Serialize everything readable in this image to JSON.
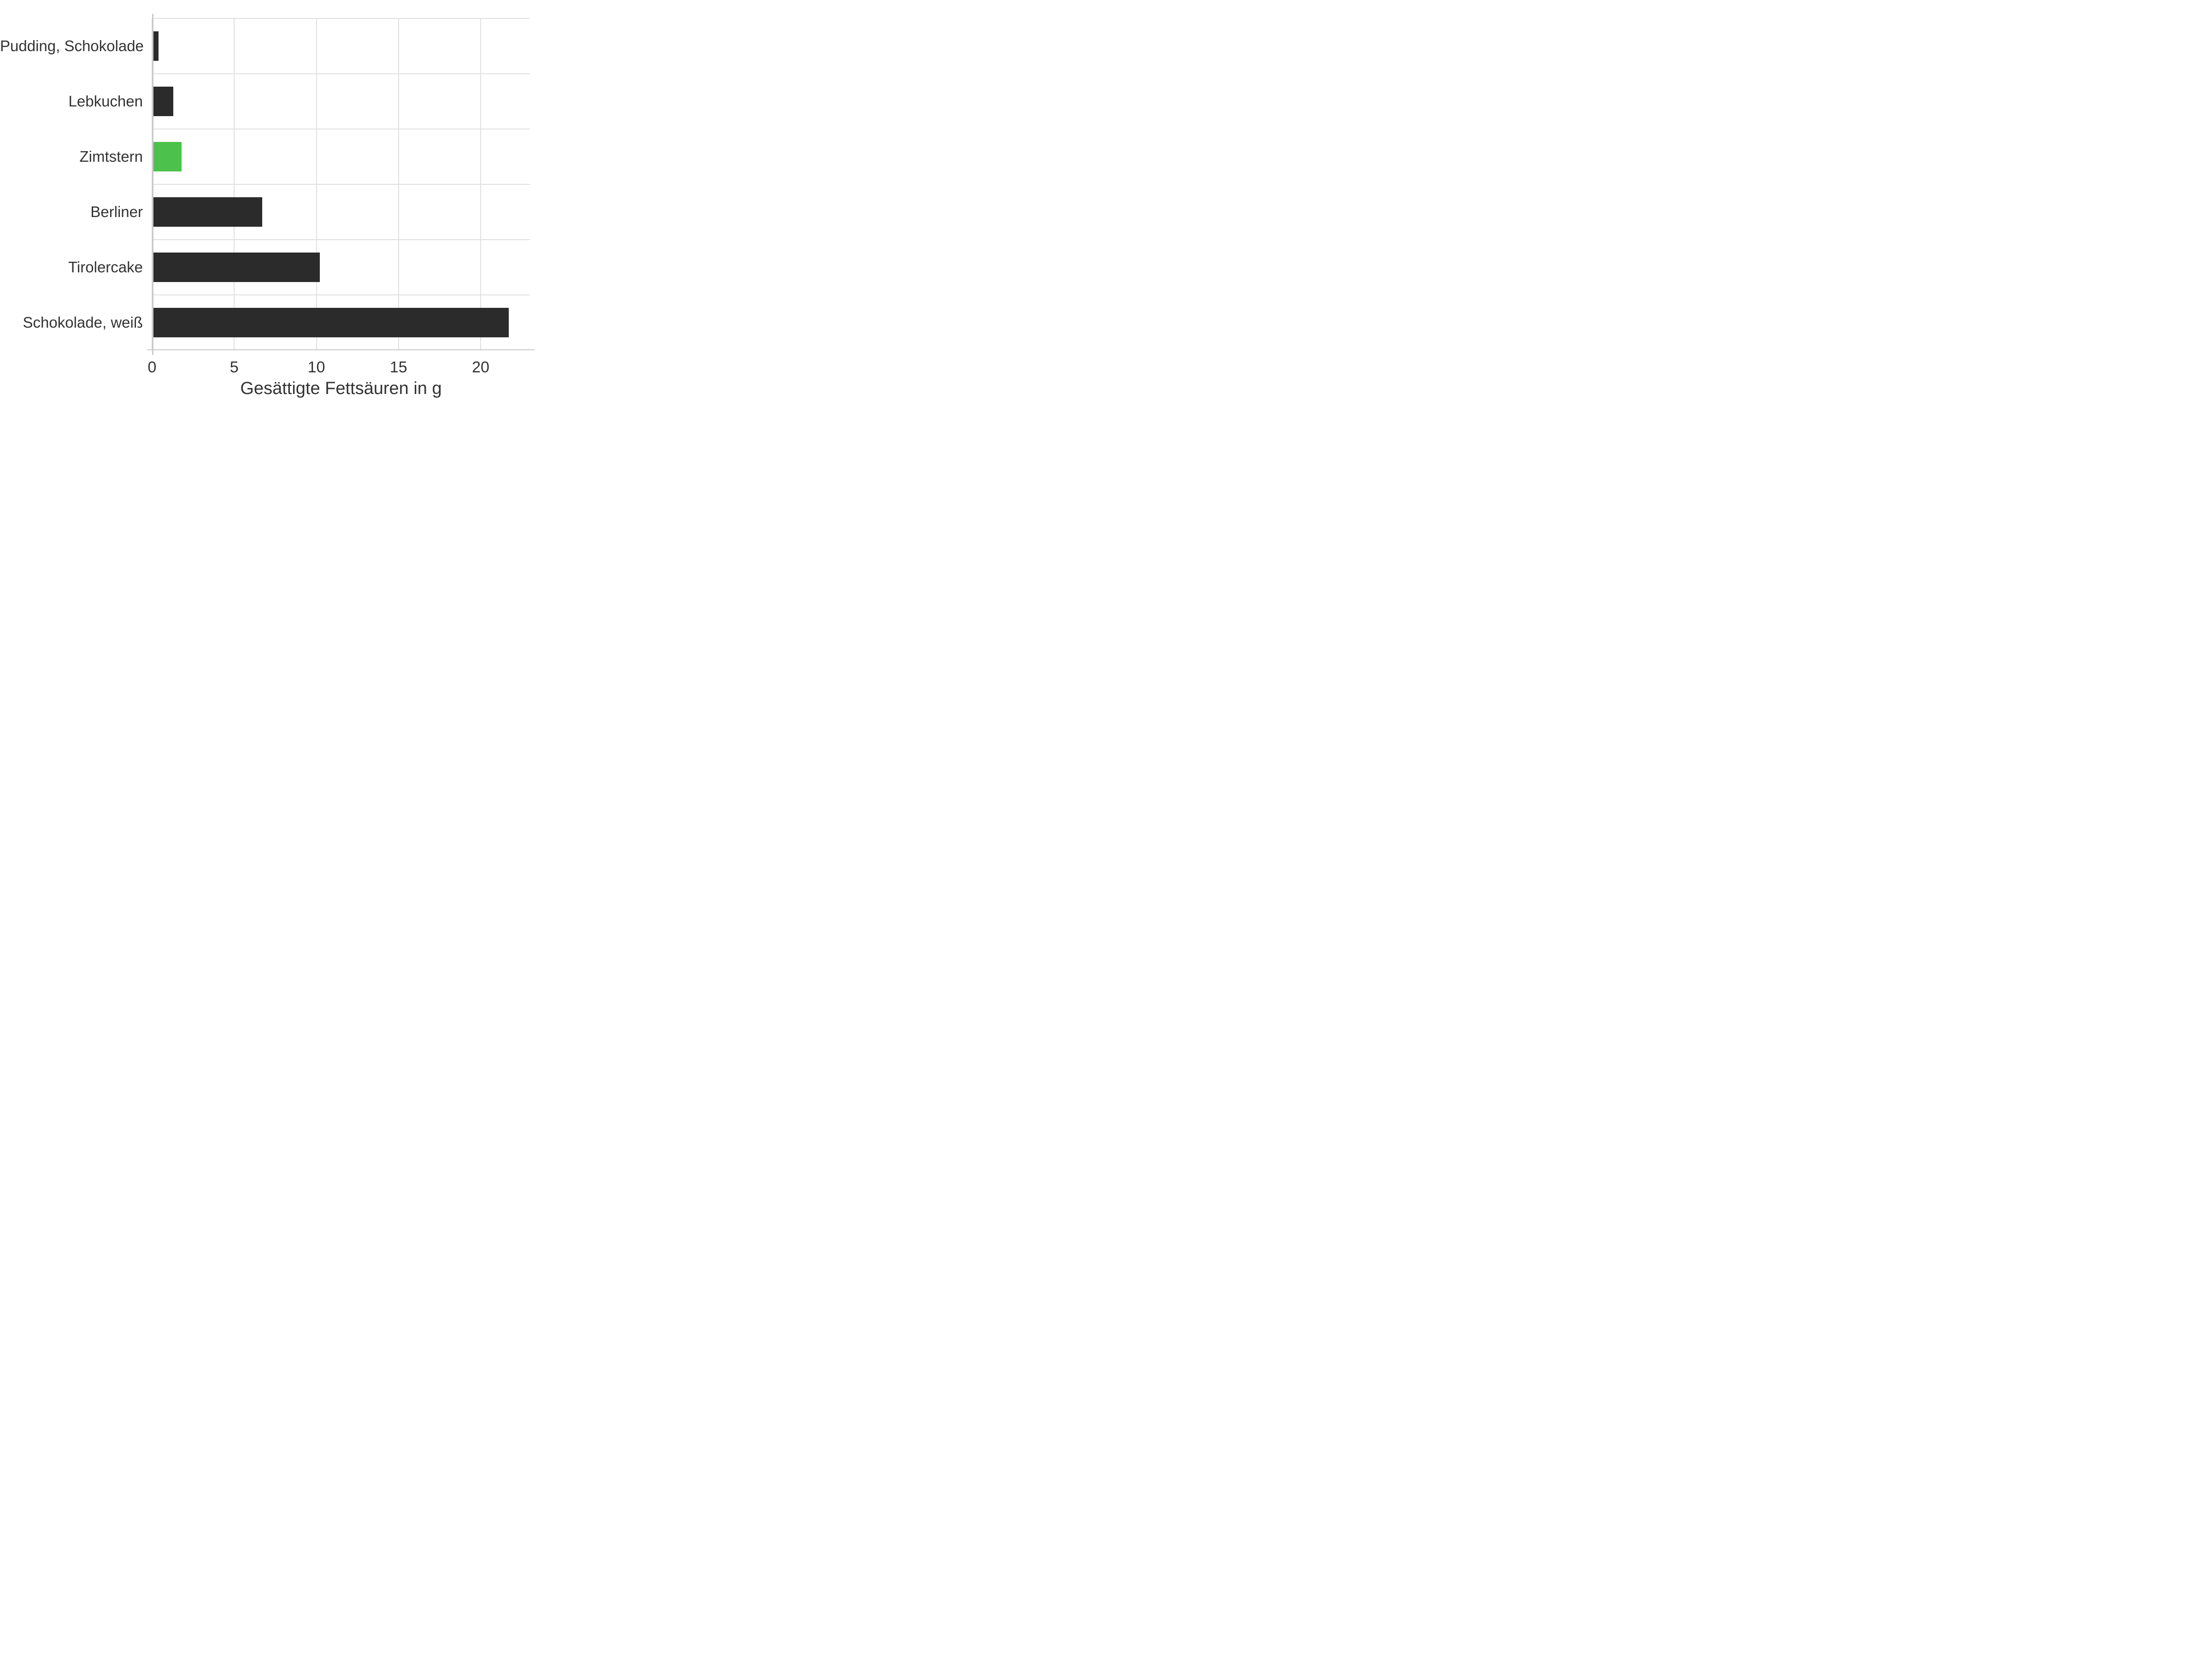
{
  "chart_data": {
    "type": "bar",
    "orientation": "horizontal",
    "categories": [
      "Pudding, Schokolade",
      "Lebkuchen",
      "Zimtstern",
      "Berliner",
      "Tirolercake",
      "Schokolade, weiß"
    ],
    "values": [
      0.4,
      1.3,
      1.8,
      6.7,
      10.2,
      21.7
    ],
    "highlight_index": 2,
    "xlabel": "Gesättigte Fettsäuren in g",
    "ylabel": "",
    "title": "",
    "xlim": [
      0,
      23
    ],
    "x_ticks": [
      0,
      5,
      10,
      15,
      20
    ],
    "colors": {
      "default": "#2b2b2b",
      "highlight": "#4cc14c"
    }
  }
}
